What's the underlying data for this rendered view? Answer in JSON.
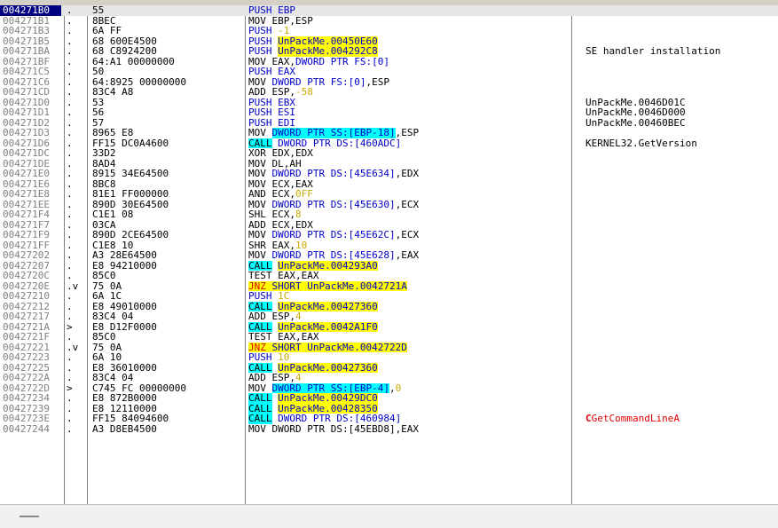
{
  "rows": [
    {
      "addr": "004271B0",
      "mark": ".",
      "hex": "55",
      "dis": [
        {
          "t": "PUSH EBP",
          "c": "push"
        }
      ],
      "comment": "",
      "selected": true
    },
    {
      "addr": "004271B1",
      "mark": ".",
      "hex": "8BEC",
      "dis": [
        {
          "t": "MOV EBP,ESP"
        }
      ],
      "comment": ""
    },
    {
      "addr": "004271B3",
      "mark": ".",
      "hex": "6A FF",
      "dis": [
        {
          "t": "PUSH ",
          "c": "push"
        },
        {
          "t": "-1",
          "c": "num"
        }
      ],
      "comment": ""
    },
    {
      "addr": "004271B5",
      "mark": ".",
      "hex": "68 600E4500",
      "dis": [
        {
          "t": "PUSH ",
          "c": "push"
        },
        {
          "t": "UnPackMe.00450E60",
          "c": "label"
        }
      ],
      "comment": ""
    },
    {
      "addr": "004271BA",
      "mark": ".",
      "hex": "68 C8924200",
      "dis": [
        {
          "t": "PUSH ",
          "c": "push"
        },
        {
          "t": "UnPackMe.004292C8",
          "c": "label"
        }
      ],
      "comment": "SE handler installation"
    },
    {
      "addr": "004271BF",
      "mark": ".",
      "hex": "64:A1 00000000",
      "dis": [
        {
          "t": "MOV EAX,"
        },
        {
          "t": "DWORD PTR FS:[0]",
          "c": "blue"
        }
      ],
      "comment": ""
    },
    {
      "addr": "004271C5",
      "mark": ".",
      "hex": "50",
      "dis": [
        {
          "t": "PUSH EAX",
          "c": "push"
        }
      ],
      "comment": ""
    },
    {
      "addr": "004271C6",
      "mark": ".",
      "hex": "64:8925 00000000",
      "dis": [
        {
          "t": "MOV "
        },
        {
          "t": "DWORD PTR FS:[0]",
          "c": "blue"
        },
        {
          "t": ",ESP"
        }
      ],
      "comment": ""
    },
    {
      "addr": "004271CD",
      "mark": ".",
      "hex": "83C4 A8",
      "dis": [
        {
          "t": "ADD ESP,"
        },
        {
          "t": "-58",
          "c": "num"
        }
      ],
      "comment": ""
    },
    {
      "addr": "004271D0",
      "mark": ".",
      "hex": "53",
      "dis": [
        {
          "t": "PUSH EBX",
          "c": "push"
        }
      ],
      "comment": "UnPackMe.0046D01C"
    },
    {
      "addr": "004271D1",
      "mark": ".",
      "hex": "56",
      "dis": [
        {
          "t": "PUSH ESI",
          "c": "push"
        }
      ],
      "comment": "UnPackMe.0046D000"
    },
    {
      "addr": "004271D2",
      "mark": ".",
      "hex": "57",
      "dis": [
        {
          "t": "PUSH EDI",
          "c": "push"
        }
      ],
      "comment": "UnPackMe.00460BEC"
    },
    {
      "addr": "004271D3",
      "mark": ".",
      "hex": "8965 E8",
      "dis": [
        {
          "t": "MOV "
        },
        {
          "t": "DWORD PTR SS:[EBP-18]",
          "c": "mem"
        },
        {
          "t": ",ESP"
        }
      ],
      "comment": ""
    },
    {
      "addr": "004271D6",
      "mark": ".",
      "hex": "FF15 DC0A4600",
      "dis": [
        {
          "t": "CALL",
          "c": "call"
        },
        {
          "t": " DWORD PTR DS:[460ADC]",
          "c": "blue"
        }
      ],
      "comment": "KERNEL32.GetVersion"
    },
    {
      "addr": "004271DC",
      "mark": ".",
      "hex": "33D2",
      "dis": [
        {
          "t": "XOR EDX,EDX"
        }
      ],
      "comment": ""
    },
    {
      "addr": "004271DE",
      "mark": ".",
      "hex": "8AD4",
      "dis": [
        {
          "t": "MOV DL,AH"
        }
      ],
      "comment": ""
    },
    {
      "addr": "004271E0",
      "mark": ".",
      "hex": "8915 34E64500",
      "dis": [
        {
          "t": "MOV "
        },
        {
          "t": "DWORD PTR DS:[45E634]",
          "c": "blue"
        },
        {
          "t": ",EDX"
        }
      ],
      "comment": ""
    },
    {
      "addr": "004271E6",
      "mark": ".",
      "hex": "8BC8",
      "dis": [
        {
          "t": "MOV ECX,EAX"
        }
      ],
      "comment": ""
    },
    {
      "addr": "004271E8",
      "mark": ".",
      "hex": "81E1 FF000000",
      "dis": [
        {
          "t": "AND ECX,"
        },
        {
          "t": "0FF",
          "c": "num"
        }
      ],
      "comment": ""
    },
    {
      "addr": "004271EE",
      "mark": ".",
      "hex": "890D 30E64500",
      "dis": [
        {
          "t": "MOV "
        },
        {
          "t": "DWORD PTR DS:[45E630]",
          "c": "blue"
        },
        {
          "t": ",ECX"
        }
      ],
      "comment": ""
    },
    {
      "addr": "004271F4",
      "mark": ".",
      "hex": "C1E1 08",
      "dis": [
        {
          "t": "SHL ECX,"
        },
        {
          "t": "8",
          "c": "num"
        }
      ],
      "comment": ""
    },
    {
      "addr": "004271F7",
      "mark": ".",
      "hex": "03CA",
      "dis": [
        {
          "t": "ADD ECX,EDX"
        }
      ],
      "comment": ""
    },
    {
      "addr": "004271F9",
      "mark": ".",
      "hex": "890D 2CE64500",
      "dis": [
        {
          "t": "MOV "
        },
        {
          "t": "DWORD PTR DS:[45E62C]",
          "c": "blue"
        },
        {
          "t": ",ECX"
        }
      ],
      "comment": ""
    },
    {
      "addr": "004271FF",
      "mark": ".",
      "hex": "C1E8 10",
      "dis": [
        {
          "t": "SHR EAX,"
        },
        {
          "t": "10",
          "c": "num"
        }
      ],
      "comment": ""
    },
    {
      "addr": "00427202",
      "mark": ".",
      "hex": "A3 28E64500",
      "dis": [
        {
          "t": "MOV "
        },
        {
          "t": "DWORD PTR DS:[45E628]",
          "c": "blue"
        },
        {
          "t": ",EAX"
        }
      ],
      "comment": ""
    },
    {
      "addr": "00427207",
      "mark": ".",
      "hex": "E8 94210000",
      "dis": [
        {
          "t": "CALL",
          "c": "call"
        },
        {
          "t": " "
        },
        {
          "t": "UnPackMe.004293A0",
          "c": "label"
        }
      ],
      "comment": ""
    },
    {
      "addr": "0042720C",
      "mark": ".",
      "hex": "85C0",
      "dis": [
        {
          "t": "TEST EAX,EAX"
        }
      ],
      "comment": ""
    },
    {
      "addr": "0042720E",
      "mark": ".v",
      "hex": "75 0A",
      "dis": [
        {
          "t": "JNZ",
          "c": "jnz"
        },
        {
          "t": " SHORT UnPackMe.0042721A",
          "c": "label"
        }
      ],
      "comment": ""
    },
    {
      "addr": "00427210",
      "mark": ".",
      "hex": "6A 1C",
      "dis": [
        {
          "t": "PUSH ",
          "c": "push"
        },
        {
          "t": "1C",
          "c": "num"
        }
      ],
      "comment": ""
    },
    {
      "addr": "00427212",
      "mark": ".",
      "hex": "E8 49010000",
      "dis": [
        {
          "t": "CALL",
          "c": "call"
        },
        {
          "t": " "
        },
        {
          "t": "UnPackMe.00427360",
          "c": "label"
        }
      ],
      "comment": ""
    },
    {
      "addr": "00427217",
      "mark": ".",
      "hex": "83C4 04",
      "dis": [
        {
          "t": "ADD ESP,"
        },
        {
          "t": "4",
          "c": "num"
        }
      ],
      "comment": ""
    },
    {
      "addr": "0042721A",
      "mark": ">",
      "hex": "E8 D12F0000",
      "dis": [
        {
          "t": "CALL",
          "c": "call"
        },
        {
          "t": " "
        },
        {
          "t": "UnPackMe.0042A1F0",
          "c": "label"
        }
      ],
      "comment": ""
    },
    {
      "addr": "0042721F",
      "mark": ".",
      "hex": "85C0",
      "dis": [
        {
          "t": "TEST EAX,EAX"
        }
      ],
      "comment": ""
    },
    {
      "addr": "00427221",
      "mark": ".v",
      "hex": "75 0A",
      "dis": [
        {
          "t": "JNZ",
          "c": "jnz"
        },
        {
          "t": " SHORT UnPackMe.0042722D",
          "c": "label"
        }
      ],
      "comment": ""
    },
    {
      "addr": "00427223",
      "mark": ".",
      "hex": "6A 10",
      "dis": [
        {
          "t": "PUSH ",
          "c": "push"
        },
        {
          "t": "10",
          "c": "num"
        }
      ],
      "comment": ""
    },
    {
      "addr": "00427225",
      "mark": ".",
      "hex": "E8 36010000",
      "dis": [
        {
          "t": "CALL",
          "c": "call"
        },
        {
          "t": " "
        },
        {
          "t": "UnPackMe.00427360",
          "c": "label"
        }
      ],
      "comment": ""
    },
    {
      "addr": "0042722A",
      "mark": ".",
      "hex": "83C4 04",
      "dis": [
        {
          "t": "ADD ESP,"
        },
        {
          "t": "4",
          "c": "num"
        }
      ],
      "comment": ""
    },
    {
      "addr": "0042722D",
      "mark": ">",
      "hex": "C745 FC 00000000",
      "dis": [
        {
          "t": "MOV "
        },
        {
          "t": "DWORD PTR SS:[EBP-4]",
          "c": "mem"
        },
        {
          "t": ","
        },
        {
          "t": "0",
          "c": "num"
        }
      ],
      "comment": ""
    },
    {
      "addr": "00427234",
      "mark": ".",
      "hex": "E8 872B0000",
      "dis": [
        {
          "t": "CALL",
          "c": "call"
        },
        {
          "t": " "
        },
        {
          "t": "UnPackMe.00429DC0",
          "c": "label"
        }
      ],
      "comment": ""
    },
    {
      "addr": "00427239",
      "mark": ".",
      "hex": "E8 12110000",
      "dis": [
        {
          "t": "CALL",
          "c": "call"
        },
        {
          "t": " "
        },
        {
          "t": "UnPackMe.00428350",
          "c": "label"
        }
      ],
      "comment": ""
    },
    {
      "addr": "0042723E",
      "mark": ".",
      "hex": "FF15 84094600",
      "dis": [
        {
          "t": "CALL",
          "c": "call"
        },
        {
          "t": " DWORD PTR DS:[460984]",
          "c": "blue"
        }
      ],
      "comment": "GetCommandLineA",
      "comment_prefix": "C",
      "comment_color": "red"
    },
    {
      "addr": "00427244",
      "mark": ".",
      "hex": "A3 D8EB4500",
      "dis": [
        {
          "t": "MOV DWORD PTR DS:[45EBD8],EAX"
        }
      ],
      "comment": ""
    }
  ]
}
